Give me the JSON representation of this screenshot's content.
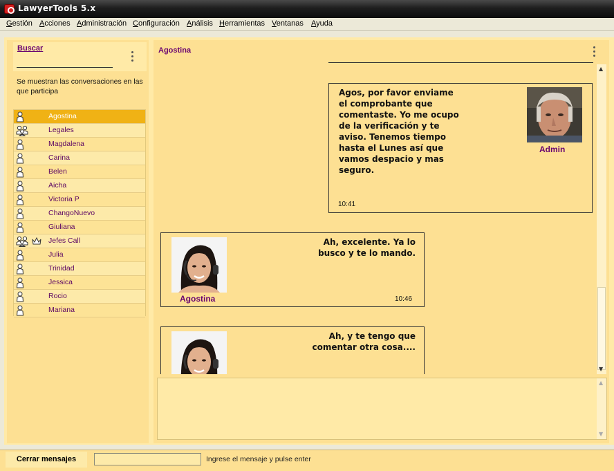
{
  "window": {
    "title": "LawyerTools 5.x"
  },
  "menu": {
    "items": [
      "Gestión",
      "Acciones",
      "Administración",
      "Configuración",
      "Análisis",
      "Herramientas",
      "Ventanas",
      "Ayuda"
    ]
  },
  "search": {
    "label": "Buscar",
    "description": "Se muestran las conversaciones en las que participa"
  },
  "contacts": [
    {
      "name": "Agostina",
      "type": "person",
      "selected": true
    },
    {
      "name": "Legales",
      "type": "group"
    },
    {
      "name": "Magdalena",
      "type": "person"
    },
    {
      "name": "Carina",
      "type": "person"
    },
    {
      "name": "Belen",
      "type": "person"
    },
    {
      "name": "Aicha",
      "type": "person"
    },
    {
      "name": "Victoria P",
      "type": "person"
    },
    {
      "name": "ChangoNuevo",
      "type": "person"
    },
    {
      "name": "Giuliana",
      "type": "person"
    },
    {
      "name": "Jefes Call",
      "type": "group",
      "crown": true
    },
    {
      "name": "Julia",
      "type": "person"
    },
    {
      "name": "Trinidad",
      "type": "person"
    },
    {
      "name": "Jessica",
      "type": "person"
    },
    {
      "name": "Rocio",
      "type": "person"
    },
    {
      "name": "Mariana",
      "type": "person"
    }
  ],
  "chat": {
    "header": "Agostina",
    "messages": [
      {
        "author": "Admin",
        "text": "Agos, por favor enviame el comprobante que comentaste. Yo me ocupo de la verificación y te aviso. Tenemos tiempo hasta el Lunes así que vamos despacio y mas seguro.",
        "time": "10:41"
      },
      {
        "author": "Agostina",
        "text": "Ah, excelente. Ya lo busco y te lo mando.",
        "time": "10:46"
      },
      {
        "author": "Agostina",
        "text": "Ah, y te tengo que comentar otra cosa....",
        "time": ""
      }
    ]
  },
  "bottom": {
    "close_label": "Cerrar mensajes",
    "status_hint": "Ingrese el mensaje y pulse enter"
  },
  "colors": {
    "accent": "#6a0470",
    "panel": "#fde093",
    "selected": "#f0b215"
  }
}
